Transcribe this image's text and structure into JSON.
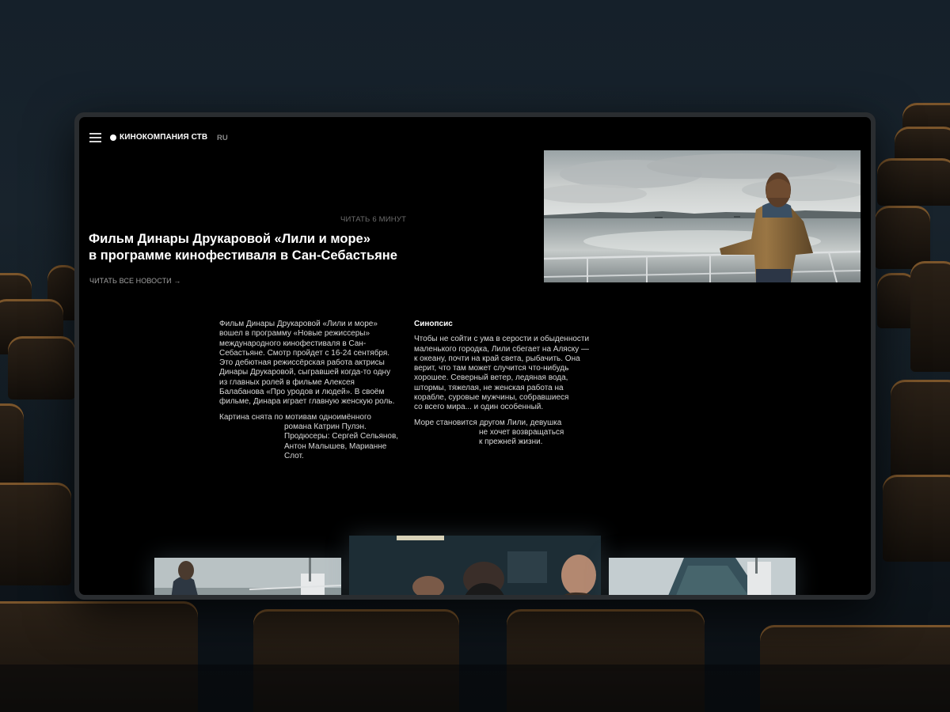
{
  "header": {
    "brand": "КИНОКОМПАНИЯ СТВ",
    "lang": "RU"
  },
  "article": {
    "read_time": "ЧИТАТЬ 6 МИНУТ",
    "title_line1": "Фильм Динары Друкаровой «Лили и море»",
    "title_line2": "в программе кинофестиваля в Сан-Себастьяне",
    "all_news": "ЧИТАТЬ ВСЕ НОВОСТИ →"
  },
  "body": {
    "p1": "Фильм Динары Друкаровой «Лили и море»\nвошел в программу «Новые режиссеры»\nмеждународного кинофестиваля в Сан-\nСебастьяне. Смотр пройдет с 16-24 сентября.\nЭто дебютная режиссёрская работа актрисы\nДинары Друкаровой, сыгравшей когда-то одну\nиз главных ролей в фильме Алексея\nБалабанова «Про уродов и людей». В своём\nфильме, Динара играет главную женскую роль.",
    "p2_first": "Картина снята по мотивам одноимённого",
    "p2_rest": "романа Катрин Пулэн.\nПродюсеры: Сергей Сельянов,\nАнтон Малышев, Марианне\nСлот.",
    "synopsis_heading": "Синопсис",
    "synopsis_p1": "Чтобы не сойти с ума в серости и обыденности\nмаленького городка, Лили сбегает на Аляску —\nк океану, почти на край света, рыбачить. Она\nверит, что там может случится что-нибудь\nхорошее. Северный ветер, ледяная вода,\nштормы, тяжелая, не женская работа на\nкорабле, суровые мужчины, собравшиеся\nсо всего мира... и один особенный.",
    "synopsis_p2_first": "Море становится другом Лили, девушка",
    "synopsis_p2_rest": "не хочет возвращаться\nк прежней жизни."
  },
  "colors": {
    "screen_bg": "#000000",
    "text_primary": "#ffffff",
    "text_secondary": "#d9d9d9",
    "text_muted": "#6d6d6d",
    "seat_accent": "#be823c"
  }
}
